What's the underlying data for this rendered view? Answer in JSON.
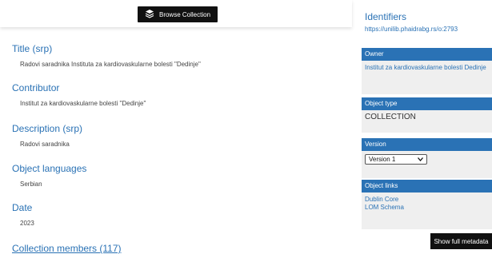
{
  "header": {
    "browse_label": "Browse Collection"
  },
  "main": {
    "title_label": "Title (srp)",
    "title_value": "Radovi saradnika Instituta za kardiovaskularne bolesti \"Dedinje\"",
    "contributor_label": "Contributor",
    "contributor_value": "Institut za kardiovaskularne bolesti \"Dedinje\"",
    "description_label": "Description (srp)",
    "description_value": "Radovi saradnika",
    "languages_label": "Object languages",
    "languages_value": "Serbian",
    "date_label": "Date",
    "date_value": "2023",
    "members_label": "Collection members (117)"
  },
  "side": {
    "identifiers_title": "Identifiers",
    "identifier_url": "https://unilib.phaidrabg.rs/o:2793",
    "owner_head": "Owner",
    "owner_value": "Institut za kardiovaskularne bolesti Dedinje",
    "type_head": "Object type",
    "type_value": "COLLECTION",
    "version_head": "Version",
    "version_selected": "Version 1",
    "links_head": "Object links",
    "link_dublin": "Dublin Core",
    "link_lom": "LOM Schema",
    "show_metadata": "Show full metadata"
  }
}
